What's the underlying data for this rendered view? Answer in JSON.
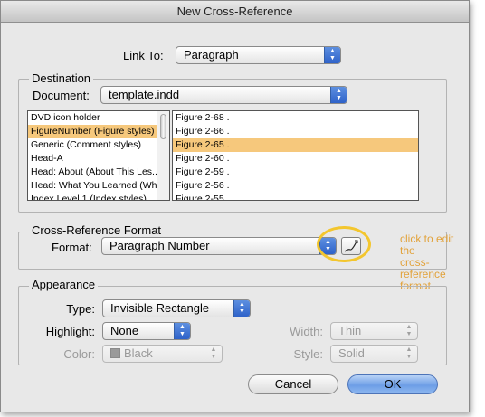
{
  "window": {
    "title": "New Cross-Reference"
  },
  "link_to": {
    "label": "Link To:",
    "value": "Paragraph"
  },
  "destination": {
    "group_title": "Destination",
    "document_label": "Document:",
    "document_value": "template.indd",
    "styles": [
      {
        "label": "DVD icon holder",
        "selected": false
      },
      {
        "label": "FigureNumber (Figure styles)",
        "selected": true
      },
      {
        "label": "Generic (Comment styles)",
        "selected": false
      },
      {
        "label": "Head-A",
        "selected": false
      },
      {
        "label": "Head: About (About This Les...",
        "selected": false
      },
      {
        "label": "Head: What You Learned (Wh...",
        "selected": false
      },
      {
        "label": "Index Level 1 (Index styles)",
        "selected": false
      }
    ],
    "paragraphs": [
      {
        "label": "Figure 2-68 .",
        "selected": false
      },
      {
        "label": "Figure 2-66 .",
        "selected": false
      },
      {
        "label": "Figure 2-65 .",
        "selected": true
      },
      {
        "label": "Figure 2-60 .",
        "selected": false
      },
      {
        "label": "Figure 2-59 .",
        "selected": false
      },
      {
        "label": "Figure 2-56 .",
        "selected": false
      },
      {
        "label": "Figure 2-55",
        "selected": false
      }
    ]
  },
  "format": {
    "group_title": "Cross-Reference Format",
    "format_label": "Format:",
    "format_value": "Paragraph Number",
    "edit_button_icon": "pencil-icon",
    "annotation": [
      "click to edit the",
      "cross-reference",
      "format"
    ],
    "annotation_color": "#e2a23a"
  },
  "appearance": {
    "group_title": "Appearance",
    "type_label": "Type:",
    "type_value": "Invisible Rectangle",
    "highlight_label": "Highlight:",
    "highlight_value": "None",
    "color_label": "Color:",
    "color_value": "Black",
    "width_label": "Width:",
    "width_value": "Thin",
    "style_label": "Style:",
    "style_value": "Solid"
  },
  "buttons": {
    "cancel": "Cancel",
    "ok": "OK"
  },
  "colors": {
    "selection": "#f6c87c",
    "accent": "#2e62c9",
    "annotation": "#f3c62e"
  }
}
